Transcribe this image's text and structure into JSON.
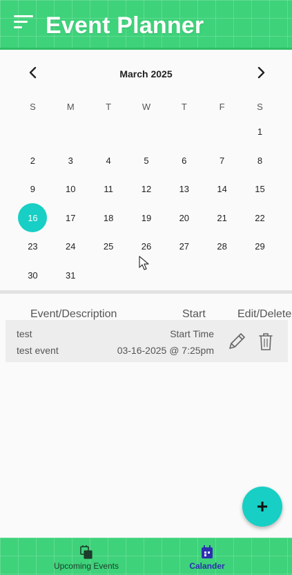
{
  "header": {
    "title": "Event Planner",
    "menu_icon": "menu-icon"
  },
  "calendar": {
    "month_label": "March 2025",
    "prev_icon": "chevron-left-icon",
    "next_icon": "chevron-right-icon",
    "weekdays": [
      "S",
      "M",
      "T",
      "W",
      "T",
      "F",
      "S"
    ],
    "leading_blanks": 6,
    "days": [
      "1",
      "2",
      "3",
      "4",
      "5",
      "6",
      "7",
      "8",
      "9",
      "10",
      "11",
      "12",
      "13",
      "14",
      "15",
      "16",
      "17",
      "18",
      "19",
      "20",
      "21",
      "22",
      "23",
      "24",
      "25",
      "26",
      "27",
      "28",
      "29",
      "30",
      "31"
    ],
    "selected_day": "16",
    "accent_color": "#17cfc4"
  },
  "event_list": {
    "headers": {
      "event": "Event/Description",
      "start": "Start",
      "actions": "Edit/Delete"
    },
    "events": [
      {
        "name": "test",
        "description": "test event",
        "start_label": "Start Time",
        "start_value": "03-16-2025 @ 7:25pm",
        "edit_icon": "pencil-icon",
        "delete_icon": "trash-icon"
      }
    ]
  },
  "fab": {
    "label": "+",
    "icon": "add-icon"
  },
  "bottom_nav": {
    "items": [
      {
        "label": "Upcoming Events",
        "icon": "calendar-list-icon",
        "active": false
      },
      {
        "label": "Calander",
        "icon": "calendar-icon",
        "active": true
      }
    ]
  },
  "colors": {
    "primary": "#3ed27a",
    "accent": "#17cfc4",
    "active_nav": "#2b2fb0"
  }
}
